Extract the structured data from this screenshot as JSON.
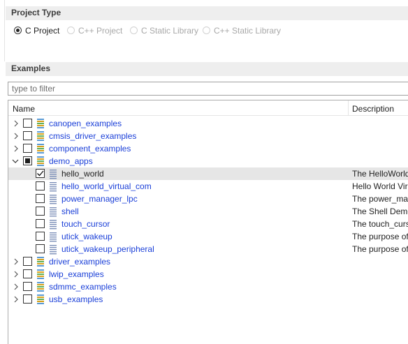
{
  "project_type": {
    "title": "Project Type",
    "options": [
      {
        "label": "C Project",
        "selected": true
      },
      {
        "label": "C++ Project",
        "selected": false
      },
      {
        "label": "C Static Library",
        "selected": false
      },
      {
        "label": "C++ Static Library",
        "selected": false
      }
    ]
  },
  "examples": {
    "title": "Examples",
    "filter_placeholder": "type to filter",
    "filter_value": "",
    "columns": {
      "name": "Name",
      "description": "Description"
    },
    "rows": [
      {
        "label": "canopen_examples",
        "type": "folder",
        "expander": "collapsed",
        "check": "unchecked",
        "description": ""
      },
      {
        "label": "cmsis_driver_examples",
        "type": "folder",
        "expander": "collapsed",
        "check": "unchecked",
        "description": ""
      },
      {
        "label": "component_examples",
        "type": "folder",
        "expander": "collapsed",
        "check": "unchecked",
        "description": ""
      },
      {
        "label": "demo_apps",
        "type": "folder",
        "expander": "expanded",
        "check": "partial",
        "description": ""
      },
      {
        "label": "hello_world",
        "type": "file",
        "check": "checked",
        "selected": true,
        "description": "The HelloWorld"
      },
      {
        "label": "hello_world_virtual_com",
        "type": "file",
        "check": "unchecked",
        "description": "Hello World Vir"
      },
      {
        "label": "power_manager_lpc",
        "type": "file",
        "check": "unchecked",
        "description": "The power_mar"
      },
      {
        "label": "shell",
        "type": "file",
        "check": "unchecked",
        "description": "The Shell Demo"
      },
      {
        "label": "touch_cursor",
        "type": "file",
        "check": "unchecked",
        "description": "The touch_curs"
      },
      {
        "label": "utick_wakeup",
        "type": "file",
        "check": "unchecked",
        "description": "The purpose of"
      },
      {
        "label": "utick_wakeup_peripheral",
        "type": "file",
        "check": "unchecked",
        "description": "The purpose of"
      },
      {
        "label": "driver_examples",
        "type": "folder",
        "expander": "collapsed",
        "check": "unchecked",
        "description": ""
      },
      {
        "label": "lwip_examples",
        "type": "folder",
        "expander": "collapsed",
        "check": "unchecked",
        "description": ""
      },
      {
        "label": "sdmmc_examples",
        "type": "folder",
        "expander": "collapsed",
        "check": "unchecked",
        "description": ""
      },
      {
        "label": "usb_examples",
        "type": "folder",
        "expander": "collapsed",
        "check": "unchecked",
        "description": ""
      }
    ]
  },
  "colors": {
    "link_text": "#1a3fd8",
    "selected_row": "#e6e6e6",
    "section_header_bg": "#eeeeee",
    "disabled_text": "#a8a8a8"
  },
  "icons": {
    "folder": "example-folder-icon",
    "file": "example-file-icon",
    "collapsed": "chevron-right-icon",
    "expanded": "chevron-down-icon"
  }
}
